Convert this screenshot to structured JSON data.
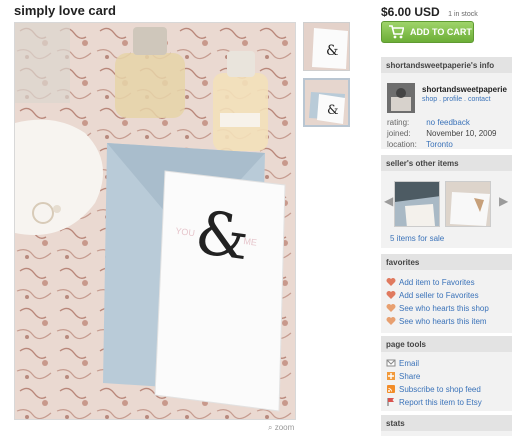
{
  "listing": {
    "title": "simply love card",
    "price": "$6.00 USD",
    "stock": "1 in stock",
    "zoom_label": "zoom"
  },
  "cart": {
    "label": "ADD TO CART"
  },
  "shop_info": {
    "heading": "shortandsweetpaperie's info",
    "name": "shortandsweetpaperie",
    "links": [
      "shop",
      "profile",
      "contact"
    ],
    "rating_label": "rating:",
    "rating_value": "no feedback",
    "joined_label": "joined:",
    "joined_value": "November 10, 2009",
    "location_label": "location:",
    "location_value": "Toronto"
  },
  "other_items": {
    "heading": "seller's other items",
    "count_label": "5 items for sale"
  },
  "favorites": {
    "heading": "favorites",
    "items": [
      "Add item to Favorites",
      "Add seller to Favorites",
      "See who hearts this shop",
      "See who hearts this item"
    ]
  },
  "page_tools": {
    "heading": "page tools",
    "items": [
      "Email",
      "Share",
      "Subscribe to shop feed",
      "Report this item to Etsy"
    ]
  },
  "stats": {
    "heading": "stats"
  },
  "colors": {
    "accent_green": "#7dbd45",
    "link_blue": "#3b73b9",
    "panel_gray": "#f2f2f2"
  },
  "icons": [
    "cart-icon",
    "chevron-left-icon",
    "chevron-right-icon",
    "heart-icon",
    "email-icon",
    "share-icon",
    "rss-icon",
    "flag-icon",
    "magnifier-icon"
  ]
}
